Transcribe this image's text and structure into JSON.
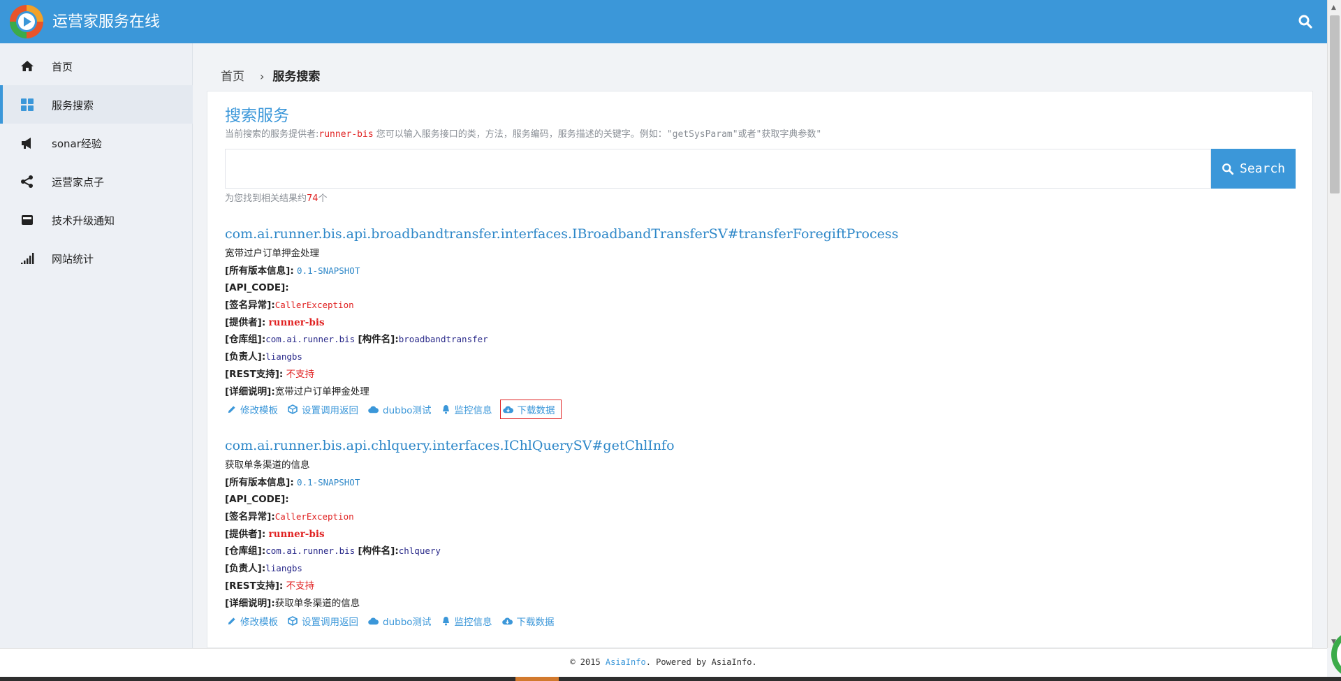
{
  "header": {
    "title": "运营家服务在线",
    "search_icon": "search-icon",
    "color": "#3b97d9"
  },
  "sidebar": {
    "items": [
      {
        "label": "首页",
        "icon": "home-icon"
      },
      {
        "label": "服务搜索",
        "icon": "grid-icon",
        "active": true
      },
      {
        "label": "sonar经验",
        "icon": "megaphone-icon"
      },
      {
        "label": "运营家点子",
        "icon": "share-icon"
      },
      {
        "label": "技术升级通知",
        "icon": "envelope-icon"
      },
      {
        "label": "网站统计",
        "icon": "signal-bars-icon"
      }
    ]
  },
  "breadcrumb": {
    "home": "首页",
    "current": "服务搜索"
  },
  "search": {
    "title": "搜索服务",
    "desc_prefix": "当前搜索的服务提供者:",
    "provider": "runner-bis",
    "desc_middle": " 您可以输入服务接口的类，方法，服务编码，服务描述的关键字。例如：",
    "desc_example": "\"getSysParam\"或者\"获取字典参数\"",
    "input_value": "",
    "input_placeholder": "",
    "button_label": "Search",
    "result_prefix": "为您找到相关结果约",
    "result_count": "74",
    "result_suffix": "个"
  },
  "labels": {
    "versions": "[所有版本信息]:",
    "api_code": "[API_CODE]:",
    "exception": "[签名异常]:",
    "provider": "[提供者]:",
    "repo_group": "[仓库组]:",
    "artifact": "[构件名]:",
    "owner": "[负责人]:",
    "rest": "[REST支持]:",
    "detail": "[详细说明]:"
  },
  "actions": {
    "edit": "修改模板",
    "set_return": "设置调用返回",
    "dubbo_test": "dubbo测试",
    "monitor": "监控信息",
    "download": "下载数据"
  },
  "results": [
    {
      "title": "com.ai.runner.bis.api.broadbandtransfer.interfaces.IBroadbandTransferSV#transferForegiftProcess",
      "summary": "宽带过户订单押金处理",
      "versions": "0.1-SNAPSHOT",
      "api_code": "",
      "exception": "CallerException",
      "provider": "runner-bis",
      "repo_group": "com.ai.runner.bis",
      "artifact": "broadbandtransfer",
      "owner": "liangbs",
      "rest": "不支持",
      "detail": "宽带过户订单押金处理"
    },
    {
      "title": "com.ai.runner.bis.api.chlquery.interfaces.IChlQuerySV#getChlInfo",
      "summary": "获取单条渠道的信息",
      "versions": "0.1-SNAPSHOT",
      "api_code": "",
      "exception": "CallerException",
      "provider": "runner-bis",
      "repo_group": "com.ai.runner.bis",
      "artifact": "chlquery",
      "owner": "liangbs",
      "rest": "不支持",
      "detail": "获取单条渠道的信息"
    }
  ],
  "footer": {
    "prefix": "© 2015 ",
    "link": "AsiaInfo",
    "suffix": ". Powered by AsiaInfo."
  }
}
